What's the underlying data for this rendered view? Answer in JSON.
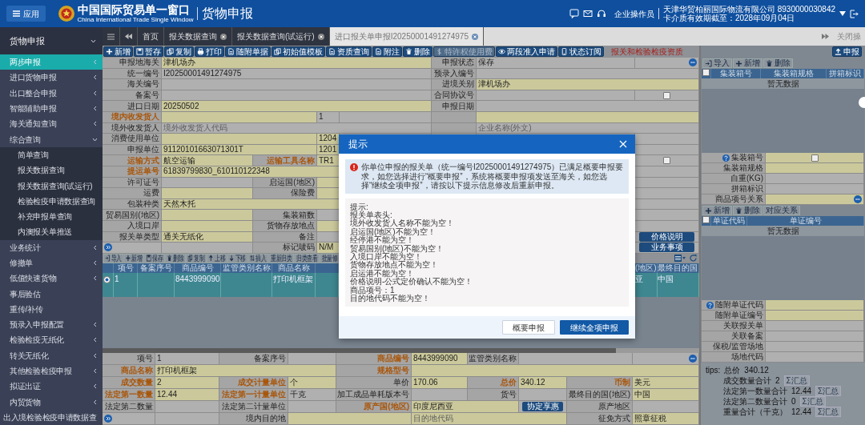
{
  "header": {
    "app_button": "应用",
    "logo_title": "中国国际贸易单一窗口",
    "logo_subtitle": "China International Trade Single Window",
    "page_title": "货物申报",
    "user_role": "企业操作员",
    "company": "天津华贸柏丽国际物流有限公司 8930000030842",
    "card_expiry": "卡介质有效期截至：2028年09月04日"
  },
  "tabs": {
    "items": [
      {
        "label": "首页",
        "selected": false,
        "closable": false
      },
      {
        "label": "报关数据查询",
        "selected": false,
        "closable": true
      },
      {
        "label": "报关数据查询(试运行)",
        "selected": false,
        "closable": true
      },
      {
        "label": "进口报关单申报I20250001491274975",
        "selected": true,
        "closable": true
      }
    ],
    "close_ops": "关闭操"
  },
  "sidebar": {
    "title": "货物申报",
    "items": [
      {
        "label": "两步申报",
        "selected": true,
        "expandable": true,
        "expanded": false
      },
      {
        "label": "进口货物申报",
        "selected": false,
        "expandable": true,
        "expanded": false
      },
      {
        "label": "出口整合申报",
        "selected": false,
        "expandable": true,
        "expanded": false
      },
      {
        "label": "智能辅助申报",
        "selected": false,
        "expandable": true,
        "expanded": false
      },
      {
        "label": "海关通知查询",
        "selected": false,
        "expandable": true,
        "expanded": false
      },
      {
        "label": "综合查询",
        "selected": false,
        "expandable": true,
        "expanded": true,
        "children": [
          {
            "label": "简单查询",
            "selected": false
          },
          {
            "label": "报关数据查询",
            "selected": false
          },
          {
            "label": "报关数据查询(试运行)",
            "selected": false
          },
          {
            "label": "检验检疫申请数据查询",
            "selected": false
          },
          {
            "label": "补充申报单查询",
            "selected": false
          },
          {
            "label": "内澳报关单推送",
            "selected": false
          }
        ]
      },
      {
        "label": "业务统计",
        "selected": false,
        "expandable": true,
        "expanded": false
      },
      {
        "label": "修撤单",
        "selected": false,
        "expandable": true,
        "expanded": false
      },
      {
        "label": "低值快速货物",
        "selected": false,
        "expandable": true,
        "expanded": false
      },
      {
        "label": "事后验估",
        "selected": false,
        "expandable": false
      },
      {
        "label": "重传/补传",
        "selected": false,
        "expandable": false
      },
      {
        "label": "预录入申报配置",
        "selected": false,
        "expandable": true,
        "expanded": false
      },
      {
        "label": "检验检疫无纸化",
        "selected": false,
        "expandable": true,
        "expanded": false
      },
      {
        "label": "转关无纸化",
        "selected": false,
        "expandable": true,
        "expanded": false
      },
      {
        "label": "其他检验检疫申报",
        "selected": false,
        "expandable": true,
        "expanded": false
      },
      {
        "label": "拟证出证",
        "selected": false,
        "expandable": true,
        "expanded": false
      },
      {
        "label": "内贸货物",
        "selected": false,
        "expandable": true,
        "expanded": false
      },
      {
        "label": "出入境检验检疫申请数据查",
        "selected": false,
        "expandable": false
      }
    ]
  },
  "toolbar": {
    "buttons": [
      {
        "label": "新增",
        "disabled": false
      },
      {
        "label": "暂存",
        "disabled": false
      },
      {
        "label": "复制",
        "disabled": false
      },
      {
        "label": "打印",
        "disabled": false
      },
      {
        "label": "随附单据",
        "disabled": false
      },
      {
        "label": "初始值模板",
        "disabled": false
      },
      {
        "label": "资质查询",
        "disabled": false
      },
      {
        "label": "附注",
        "disabled": false
      },
      {
        "label": "删除",
        "disabled": false
      },
      {
        "label": "特许权使用费",
        "disabled": true
      },
      {
        "label": "两段准入申请",
        "disabled": false
      },
      {
        "label": "状态订阅",
        "disabled": false
      }
    ],
    "notice": "报关和检验检疫资质",
    "submit": "申报"
  },
  "form": {
    "rows": [
      {
        "kind": "two_pair_side",
        "items": [
          {
            "kind": "label",
            "text": "申报地海关"
          },
          {
            "kind": "value",
            "required": true,
            "text": "津机场办"
          },
          {
            "kind": "label",
            "text": "申报状态"
          },
          {
            "kind": "value",
            "required": false,
            "text": "保存"
          },
          {
            "kind": "more"
          }
        ]
      },
      {
        "kind": "two_pair",
        "items": [
          {
            "kind": "label",
            "text": "统一编号"
          },
          {
            "kind": "value",
            "required": false,
            "text": "I20250001491274975"
          },
          {
            "kind": "label",
            "text": "预录入编号"
          },
          {
            "kind": "value",
            "required": false
          }
        ]
      },
      {
        "kind": "two_pair",
        "items": [
          {
            "kind": "label",
            "text": "海关编号"
          },
          {
            "kind": "value",
            "required": false
          },
          {
            "kind": "label",
            "text": "进境关别"
          },
          {
            "kind": "value",
            "required": true,
            "text": "津机场办"
          }
        ]
      },
      {
        "kind": "two_pair_side",
        "items": [
          {
            "kind": "label",
            "text": "备案号"
          },
          {
            "kind": "value",
            "required": false
          },
          {
            "kind": "label",
            "text": "合同协议号"
          },
          {
            "kind": "value",
            "required": false
          },
          {
            "kind": "checkbox",
            "checked": false
          }
        ]
      },
      {
        "kind": "two_pair",
        "items": [
          {
            "kind": "label",
            "text": "进口日期"
          },
          {
            "kind": "value",
            "required": true,
            "text": "20250502"
          },
          {
            "kind": "label",
            "text": "申报日期"
          },
          {
            "kind": "value",
            "required": false
          }
        ]
      },
      {
        "kind": "two_pair_extra",
        "items": [
          {
            "kind": "label",
            "text": "境内收发货人",
            "required": true
          },
          {
            "kind": "value",
            "required": true
          },
          {
            "kind": "value",
            "required": false,
            "text": "1"
          },
          {
            "kind": "label"
          },
          {
            "kind": "value",
            "required": true
          }
        ]
      },
      {
        "kind": "two_pair",
        "items": [
          {
            "kind": "label",
            "text": "境外收发货人"
          },
          {
            "kind": "placeholder",
            "required": false,
            "text": "境外收发货人代码"
          },
          {
            "kind": "label"
          },
          {
            "kind": "placeholder",
            "required": false,
            "text": "企业名称(外文)"
          }
        ]
      },
      {
        "kind": "two_pair_extra",
        "items": [
          {
            "kind": "label",
            "text": "消费使用单位"
          },
          {
            "kind": "value",
            "required": true
          },
          {
            "kind": "value",
            "required": true,
            "text": "1204"
          }
        ]
      },
      {
        "kind": "two_pair_extra",
        "items": [
          {
            "kind": "label",
            "text": "申报单位"
          },
          {
            "kind": "value",
            "required": true,
            "text": "91120101663071301T"
          },
          {
            "kind": "value",
            "required": true,
            "text": "1201"
          }
        ]
      },
      {
        "kind": "four_pair",
        "items": [
          {
            "kind": "label",
            "text": "运输方式",
            "required": true
          },
          {
            "kind": "value",
            "required": true,
            "text": "航空运输"
          },
          {
            "kind": "label",
            "text": "运输工具名称",
            "required": true
          },
          {
            "kind": "value",
            "required": true,
            "text": "TR1"
          },
          {
            "kind": "checkbox",
            "checked": false
          }
        ]
      },
      {
        "kind": "one_pair",
        "items": [
          {
            "kind": "label",
            "text": "提运单号",
            "required": true
          },
          {
            "kind": "value",
            "required": true,
            "text": "61839799830_610110122348"
          }
        ]
      },
      {
        "kind": "four_pair",
        "items": [
          {
            "kind": "label",
            "text": "许可证号"
          },
          {
            "kind": "value",
            "required": false
          },
          {
            "kind": "label",
            "text": "启运国(地区)"
          },
          {
            "kind": "value",
            "required": true
          }
        ]
      },
      {
        "kind": "four_pair",
        "items": [
          {
            "kind": "label",
            "text": "运费"
          },
          {
            "kind": "value",
            "required": true
          },
          {
            "kind": "label",
            "text": "保险费"
          },
          {
            "kind": "value",
            "required": true
          }
        ]
      },
      {
        "kind": "one_pair",
        "items": [
          {
            "kind": "label",
            "text": "包装种类"
          },
          {
            "kind": "value",
            "required": true,
            "text": "天然木托"
          }
        ]
      },
      {
        "kind": "four_pair",
        "items": [
          {
            "kind": "label",
            "text": "贸易国别(地区)"
          },
          {
            "kind": "value",
            "required": true
          },
          {
            "kind": "label",
            "text": "集装箱数"
          },
          {
            "kind": "value",
            "required": false
          }
        ]
      },
      {
        "kind": "four_pair",
        "items": [
          {
            "kind": "label",
            "text": "入境口岸"
          },
          {
            "kind": "value",
            "required": true
          },
          {
            "kind": "label",
            "text": "货物存放地点"
          },
          {
            "kind": "value",
            "required": true
          }
        ]
      },
      {
        "kind": "four_pair",
        "items": [
          {
            "kind": "label",
            "text": "报关单类型"
          },
          {
            "kind": "value",
            "required": true,
            "text": "通关无纸化"
          },
          {
            "kind": "label",
            "text": "备注"
          },
          {
            "kind": "value",
            "required": false
          },
          {
            "kind": "button",
            "text": "价格说明"
          }
        ]
      },
      {
        "kind": "four_pair",
        "items": [
          {
            "kind": "expand"
          },
          {
            "kind": "value",
            "required": false
          },
          {
            "kind": "label",
            "text": "标记唛码"
          },
          {
            "kind": "value",
            "required": true,
            "text": "N/M"
          },
          {
            "kind": "button",
            "text": "业务事项"
          }
        ]
      }
    ]
  },
  "goods": {
    "toolbar": [
      {
        "label": "导入"
      },
      {
        "label": "新增"
      },
      {
        "label": "保存"
      },
      {
        "label": "删除"
      },
      {
        "label": "复制"
      },
      {
        "label": "上移"
      },
      {
        "label": "下移"
      },
      {
        "label": "插入"
      },
      {
        "label": "重新归类"
      },
      {
        "label": "归类查看"
      },
      {
        "label": "批量修"
      }
    ],
    "columns": [
      "项号",
      "备案序号",
      "商品编号",
      "监管类别名称",
      "商品名称",
      "(地区)",
      "最终目的国"
    ],
    "rows": [
      {
        "selected": true,
        "cells": [
          "1",
          "",
          "8443999090",
          "",
          "打印机框架",
          "亚",
          "中国"
        ]
      }
    ],
    "detail": [
      {
        "kind": "item_four",
        "items": [
          {
            "kind": "label",
            "text": "项号"
          },
          {
            "kind": "value",
            "required": false,
            "text": "1"
          },
          {
            "kind": "label",
            "text": "备案序号"
          },
          {
            "kind": "value",
            "required": false
          },
          {
            "kind": "label",
            "text": "商品编号",
            "required": true
          },
          {
            "kind": "value",
            "required": true,
            "text": "8443999090"
          },
          {
            "kind": "label",
            "text": "监管类别名称"
          },
          {
            "kind": "value",
            "required": false
          },
          {
            "kind": "more"
          }
        ]
      },
      {
        "kind": "item_two",
        "items": [
          {
            "kind": "label",
            "text": "商品名称",
            "required": true
          },
          {
            "kind": "value",
            "required": true,
            "text": "打印机框架"
          },
          {
            "kind": "label",
            "text": "规格型号",
            "required": true
          },
          {
            "kind": "value",
            "required": true
          }
        ]
      },
      {
        "kind": "item_five",
        "items": [
          {
            "kind": "label",
            "text": "成交数量",
            "required": true
          },
          {
            "kind": "value",
            "required": true,
            "text": "2"
          },
          {
            "kind": "label",
            "text": "成交计量单位",
            "required": true
          },
          {
            "kind": "value",
            "required": true,
            "text": "个"
          },
          {
            "kind": "label",
            "text": "单价"
          },
          {
            "kind": "value",
            "required": true,
            "text": "170.06"
          },
          {
            "kind": "label",
            "text": "总价",
            "required": true
          },
          {
            "kind": "value",
            "required": true,
            "text": "340.12"
          },
          {
            "kind": "label",
            "text": "币制",
            "required": true
          },
          {
            "kind": "value",
            "required": true,
            "text": "美元"
          }
        ]
      },
      {
        "kind": "item_five",
        "items": [
          {
            "kind": "label",
            "text": "法定第一数量",
            "required": true
          },
          {
            "kind": "value",
            "required": true,
            "text": "12.44"
          },
          {
            "kind": "label",
            "text": "法定第一计量单位",
            "required": true
          },
          {
            "kind": "value",
            "required": false,
            "text": "千克"
          },
          {
            "kind": "label",
            "text": "加工成品单耗版本号"
          },
          {
            "kind": "value",
            "required": false
          },
          {
            "kind": "label",
            "text": "货号"
          },
          {
            "kind": "value",
            "required": false
          },
          {
            "kind": "label",
            "text": "最终目的国(地区)"
          },
          {
            "kind": "value",
            "required": true,
            "text": "中国"
          }
        ]
      },
      {
        "kind": "item_origin",
        "items": [
          {
            "kind": "label",
            "text": "法定第二数量"
          },
          {
            "kind": "value",
            "required": false
          },
          {
            "kind": "label",
            "text": "法定第二计量单位"
          },
          {
            "kind": "value",
            "required": false
          },
          {
            "kind": "label",
            "text": "原产国(地区)",
            "required": true
          },
          {
            "kind": "value",
            "required": true,
            "text": "印度尼西亚"
          },
          {
            "kind": "button",
            "text": "协定享惠"
          },
          {
            "kind": "label",
            "text": "原产地区"
          },
          {
            "kind": "value",
            "required": false
          }
        ]
      },
      {
        "kind": "item_destination",
        "items": [
          {
            "kind": "expand"
          },
          {
            "kind": "value",
            "required": false
          },
          {
            "kind": "label",
            "text": "境内目的地"
          },
          {
            "kind": "value",
            "required": true
          },
          {
            "kind": "placeholder",
            "required": true,
            "text": "目的地代码"
          },
          {
            "kind": "label",
            "text": "征免方式"
          },
          {
            "kind": "value",
            "required": true,
            "text": "照章征税"
          }
        ]
      }
    ]
  },
  "containers": {
    "toolbar": [
      {
        "label": "导入"
      },
      {
        "label": "新增"
      },
      {
        "label": "删除"
      }
    ],
    "all_checked": false,
    "columns": [
      "集装箱号",
      "集装箱规格",
      "拼箱标识"
    ],
    "empty": "暂无数据",
    "fields": [
      {
        "label": "集装箱号",
        "help": true,
        "required": true,
        "checked": false
      },
      {
        "label": "集装箱规格",
        "help": false,
        "required": true
      },
      {
        "label": "自重(KG)",
        "help": false,
        "required": false
      },
      {
        "label": "拼箱标识",
        "help": false,
        "required": false
      },
      {
        "label": "商品项号关系",
        "help": false,
        "required": true,
        "more": true
      }
    ]
  },
  "documents": {
    "toolbar": [
      {
        "label": "新增"
      },
      {
        "label": "删除"
      },
      {
        "label": "对应关系"
      }
    ],
    "all_checked": false,
    "columns": [
      "单证代码",
      "单证编号"
    ],
    "empty": "暂无数据",
    "fields": [
      {
        "label": "随附单证代码",
        "help": true,
        "required": true
      },
      {
        "label": "随附单证编号",
        "help": false,
        "required": true
      }
    ]
  },
  "related": [
    {
      "label": "关联报关单"
    },
    {
      "label": "关联备案"
    },
    {
      "label": "保税/监管场地"
    },
    {
      "label": "场地代码"
    }
  ],
  "tips": {
    "prefix": "tips:",
    "total_label": "总价",
    "total_value": "340.12",
    "sums": [
      {
        "label": "成交数量合计",
        "value": "2",
        "button": "Σ汇总"
      },
      {
        "label": "法定第一数量合计",
        "value": "12.44",
        "button": "Σ汇总"
      },
      {
        "label": "法定第二数量合计",
        "value": "0",
        "button": "Σ汇总"
      },
      {
        "label": "重量合计（千克）",
        "value": "12.44",
        "button": "Σ汇总"
      }
    ]
  },
  "modal": {
    "title": "提示",
    "alert": "你单位申报的报关单（统一编号I20250001491274975）已满足概要申报要求，如您选择进行“概要申报”，系统将概要申报项发送至海关，如您选择“继续全项申报”，请按以下提示信息修改后重新申报。",
    "messages": [
      "提示:",
      "报关单表头:",
      "境外收发货人名称不能为空！",
      "启运国(地区)不能为空！",
      "经停港不能为空！",
      "贸易国别(地区)不能为空！",
      "入境口岸不能为空！",
      "货物存放地点不能为空！",
      "启运港不能为空！",
      "价格说明-公式定价确认不能为空！",
      "商品项号：1",
      "目的地代码不能为空！"
    ],
    "buttons": [
      {
        "label": "概要申报",
        "primary": false
      },
      {
        "label": "继续全项申报",
        "primary": true
      }
    ]
  }
}
